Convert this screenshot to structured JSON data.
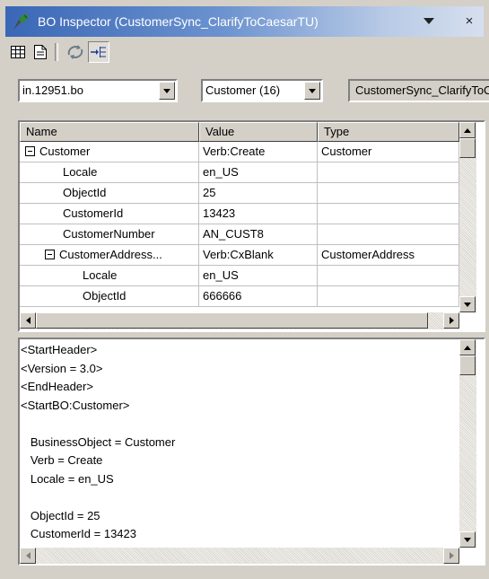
{
  "window": {
    "title": "BO Inspector (CustomerSync_ClarifyToCaesarTU)",
    "menu_icon": "chevron-down-icon",
    "close_glyph": "×"
  },
  "toolbar": {
    "icons": [
      "table-view-icon",
      "document-view-icon",
      "refresh-cycle-icon",
      "flow-tree-icon"
    ],
    "active": "flow-tree-icon"
  },
  "selectors": {
    "file": "in.12951.bo",
    "object": "Customer (16)",
    "collaboration": "CustomerSync_ClarifyToCaesarTU"
  },
  "table": {
    "columns": [
      "Name",
      "Value",
      "Type"
    ],
    "rows": [
      {
        "name": "Customer",
        "value": "Verb:Create",
        "type": "Customer",
        "expander": true,
        "level": 0
      },
      {
        "name": "Locale",
        "value": "en_US",
        "type": "",
        "expander": false,
        "level": 1
      },
      {
        "name": "ObjectId",
        "value": "25",
        "type": "",
        "expander": false,
        "level": 1
      },
      {
        "name": "CustomerId",
        "value": "13423",
        "type": "",
        "expander": false,
        "level": 1
      },
      {
        "name": "CustomerNumber",
        "value": "AN_CUST8",
        "type": "",
        "expander": false,
        "level": 1
      },
      {
        "name": "CustomerAddress...",
        "value": "Verb:CxBlank",
        "type": "CustomerAddress",
        "expander": true,
        "level": 1
      },
      {
        "name": "Locale",
        "value": "en_US",
        "type": "",
        "expander": false,
        "level": 2
      },
      {
        "name": "ObjectId",
        "value": "666666",
        "type": "",
        "expander": false,
        "level": 2
      }
    ]
  },
  "text_lines": [
    "<StartHeader>",
    "<Version = 3.0>",
    "<EndHeader>",
    "<StartBO:Customer>",
    "",
    "   BusinessObject = Customer",
    "   Verb = Create",
    "   Locale = en_US",
    "",
    "   ObjectId = 25",
    "   CustomerId = 13423"
  ],
  "colors": {
    "titlebar_start": "#3a67b6",
    "face": "#d4d0c8"
  }
}
